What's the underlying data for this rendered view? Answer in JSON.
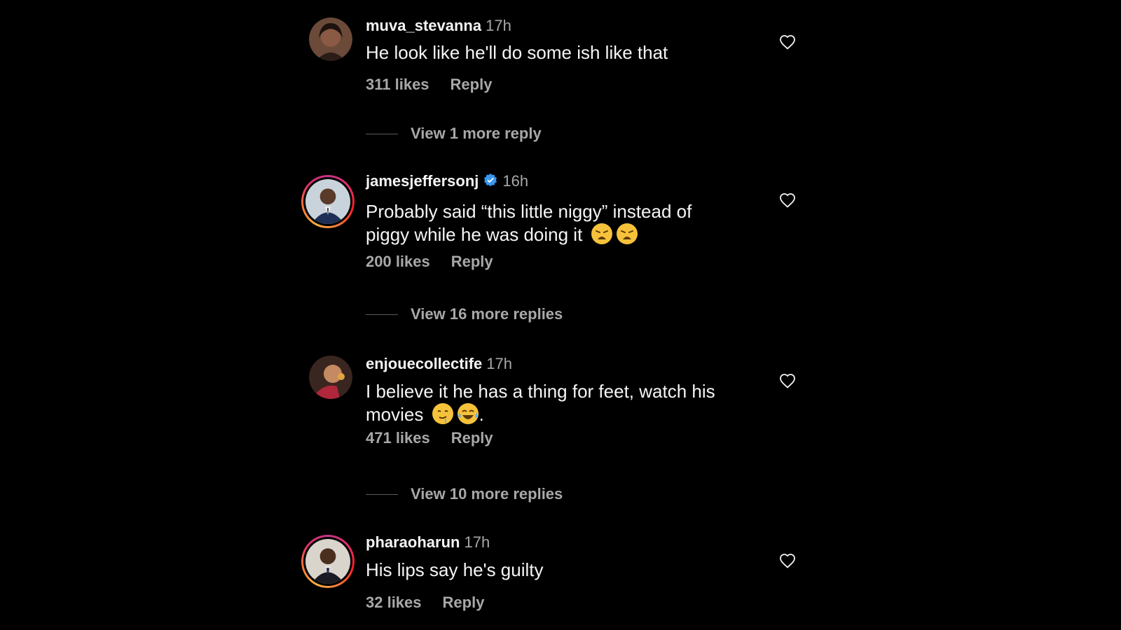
{
  "comments": [
    {
      "username": "muva_stevanna",
      "time": "17h",
      "text": "He look like he'll do some ish like that",
      "likes": "311 likes",
      "reply_label": "Reply",
      "more_replies": "View 1 more reply",
      "avatar": "profile-photo-woman"
    },
    {
      "username": "jamesjeffersonj",
      "time": "16h",
      "verified": true,
      "text_line1": "Probably said “this little niggy” instead of",
      "text_line2": "piggy while he was doing it",
      "emojis": [
        "weary-face-emoji",
        "weary-face-emoji"
      ],
      "likes": "200 likes",
      "reply_label": "Reply",
      "more_replies": "View 16 more replies",
      "avatar": "profile-photo-man-suit"
    },
    {
      "username": "enjouecollectife",
      "time": "17h",
      "text_line1": "I believe it he has a thing for feet, watch his",
      "text_line2": "movies",
      "text_suffix": ".",
      "emojis": [
        "drooling-face-emoji",
        "tears-of-joy-emoji"
      ],
      "likes": "471 likes",
      "reply_label": "Reply",
      "more_replies": "View 10 more replies",
      "avatar": "profile-photo-woman-red"
    },
    {
      "username": "pharaoharun",
      "time": "17h",
      "text": "His lips say he's guilty",
      "likes": "32 likes",
      "reply_label": "Reply",
      "avatar": "profile-photo-man-tie"
    }
  ],
  "colors": {
    "background": "#000000",
    "primary_text": "#f5f5f5",
    "secondary_text": "#a8a8a8",
    "verified_blue": "#3897f0"
  },
  "icons": {
    "like": "heart-outline-icon",
    "verified": "verified-badge-icon"
  }
}
